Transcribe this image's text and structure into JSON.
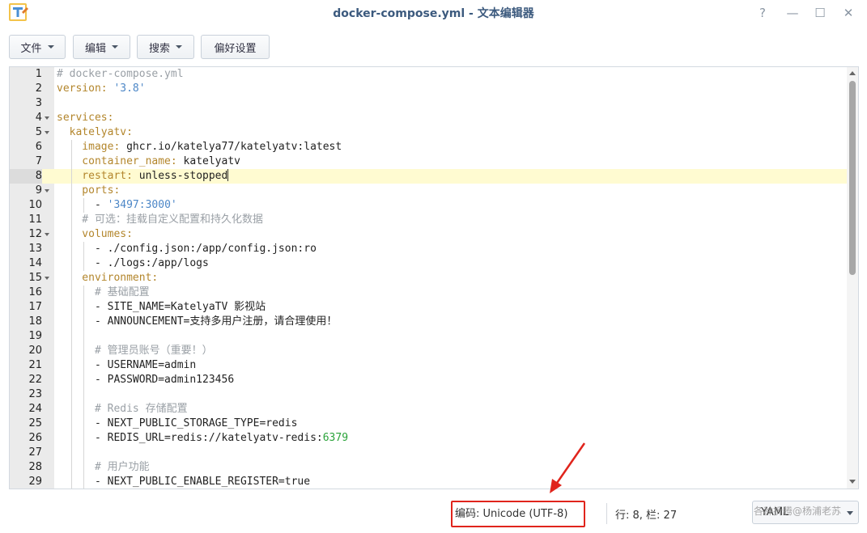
{
  "window": {
    "title": "docker-compose.yml - 文本编辑器",
    "help_label": "?",
    "minimize_label": "—",
    "maximize_label": "☐",
    "close_label": "✕"
  },
  "toolbar": {
    "file_label": "文件",
    "edit_label": "编辑",
    "search_label": "搜索",
    "prefs_label": "偏好设置"
  },
  "editor": {
    "active_line": 8,
    "lines": [
      {
        "n": "1",
        "fold": false,
        "guides": 0,
        "segs": [
          {
            "t": "# docker-compose.yml",
            "c": "c-com"
          }
        ]
      },
      {
        "n": "2",
        "fold": false,
        "guides": 0,
        "segs": [
          {
            "t": "version: ",
            "c": "c-key"
          },
          {
            "t": "'3.8'",
            "c": "c-str"
          }
        ]
      },
      {
        "n": "3",
        "fold": false,
        "guides": 0,
        "segs": []
      },
      {
        "n": "4",
        "fold": true,
        "guides": 0,
        "segs": [
          {
            "t": "services:",
            "c": "c-key"
          }
        ]
      },
      {
        "n": "5",
        "fold": true,
        "guides": 0,
        "segs": [
          {
            "t": "  katelyatv:",
            "c": "c-key"
          }
        ]
      },
      {
        "n": "6",
        "fold": false,
        "guides": 1,
        "segs": [
          {
            "t": "    image: ",
            "c": "c-key"
          },
          {
            "t": "ghcr.io/katelya77/katelyatv:latest",
            "c": ""
          }
        ]
      },
      {
        "n": "7",
        "fold": false,
        "guides": 1,
        "segs": [
          {
            "t": "    container_name: ",
            "c": "c-key"
          },
          {
            "t": "katelyatv",
            "c": ""
          }
        ]
      },
      {
        "n": "8",
        "fold": false,
        "guides": 1,
        "segs": [
          {
            "t": "    restart: ",
            "c": "c-key"
          },
          {
            "t": "unless-stopped",
            "c": ""
          }
        ]
      },
      {
        "n": "9",
        "fold": true,
        "guides": 1,
        "segs": [
          {
            "t": "    ports:",
            "c": "c-key"
          }
        ]
      },
      {
        "n": "10",
        "fold": false,
        "guides": 2,
        "segs": [
          {
            "t": "      - ",
            "c": ""
          },
          {
            "t": "'3497:3000'",
            "c": "c-str"
          }
        ]
      },
      {
        "n": "11",
        "fold": false,
        "guides": 1,
        "segs": [
          {
            "t": "    # 可选：挂载自定义配置和持久化数据",
            "c": "c-com"
          }
        ]
      },
      {
        "n": "12",
        "fold": true,
        "guides": 1,
        "segs": [
          {
            "t": "    volumes:",
            "c": "c-key"
          }
        ]
      },
      {
        "n": "13",
        "fold": false,
        "guides": 2,
        "segs": [
          {
            "t": "      - ./config.json:/app/config.json:ro",
            "c": ""
          }
        ]
      },
      {
        "n": "14",
        "fold": false,
        "guides": 2,
        "segs": [
          {
            "t": "      - ./logs:/app/logs",
            "c": ""
          }
        ]
      },
      {
        "n": "15",
        "fold": true,
        "guides": 1,
        "segs": [
          {
            "t": "    environment:",
            "c": "c-key"
          }
        ]
      },
      {
        "n": "16",
        "fold": false,
        "guides": 2,
        "segs": [
          {
            "t": "      # 基础配置",
            "c": "c-com"
          }
        ]
      },
      {
        "n": "17",
        "fold": false,
        "guides": 2,
        "segs": [
          {
            "t": "      - SITE_NAME=KatelyaTV 影视站",
            "c": ""
          }
        ]
      },
      {
        "n": "18",
        "fold": false,
        "guides": 2,
        "segs": [
          {
            "t": "      - ANNOUNCEMENT=支持多用户注册，请合理使用！",
            "c": ""
          }
        ]
      },
      {
        "n": "19",
        "fold": false,
        "guides": 2,
        "segs": []
      },
      {
        "n": "20",
        "fold": false,
        "guides": 2,
        "segs": [
          {
            "t": "      # 管理员账号（重要！）",
            "c": "c-com"
          }
        ]
      },
      {
        "n": "21",
        "fold": false,
        "guides": 2,
        "segs": [
          {
            "t": "      - USERNAME=admin",
            "c": ""
          }
        ]
      },
      {
        "n": "22",
        "fold": false,
        "guides": 2,
        "segs": [
          {
            "t": "      - PASSWORD=admin123456",
            "c": ""
          }
        ]
      },
      {
        "n": "23",
        "fold": false,
        "guides": 2,
        "segs": []
      },
      {
        "n": "24",
        "fold": false,
        "guides": 2,
        "segs": [
          {
            "t": "      # Redis 存储配置",
            "c": "c-com"
          }
        ]
      },
      {
        "n": "25",
        "fold": false,
        "guides": 2,
        "segs": [
          {
            "t": "      - NEXT_PUBLIC_STORAGE_TYPE=redis",
            "c": ""
          }
        ]
      },
      {
        "n": "26",
        "fold": false,
        "guides": 2,
        "segs": [
          {
            "t": "      - REDIS_URL=redis://katelyatv-redis:",
            "c": ""
          },
          {
            "t": "6379",
            "c": "c-num"
          }
        ]
      },
      {
        "n": "27",
        "fold": false,
        "guides": 2,
        "segs": []
      },
      {
        "n": "28",
        "fold": false,
        "guides": 2,
        "segs": [
          {
            "t": "      # 用户功能",
            "c": "c-com"
          }
        ]
      },
      {
        "n": "29",
        "fold": false,
        "guides": 2,
        "segs": [
          {
            "t": "      - NEXT_PUBLIC_ENABLE_REGISTER=true",
            "c": ""
          }
        ]
      }
    ]
  },
  "status": {
    "encoding": "编码: Unicode (UTF-8)",
    "position": "行: 8, 栏: 27",
    "language": "YAML",
    "watermark": "各种折腾@杨浦老苏"
  },
  "colors": {
    "accent_red": "#e0241c",
    "active_line_bg": "#fffbd1",
    "yaml_key": "#b3862c",
    "yaml_string": "#4d87c7",
    "comment": "#9aa0a6"
  }
}
